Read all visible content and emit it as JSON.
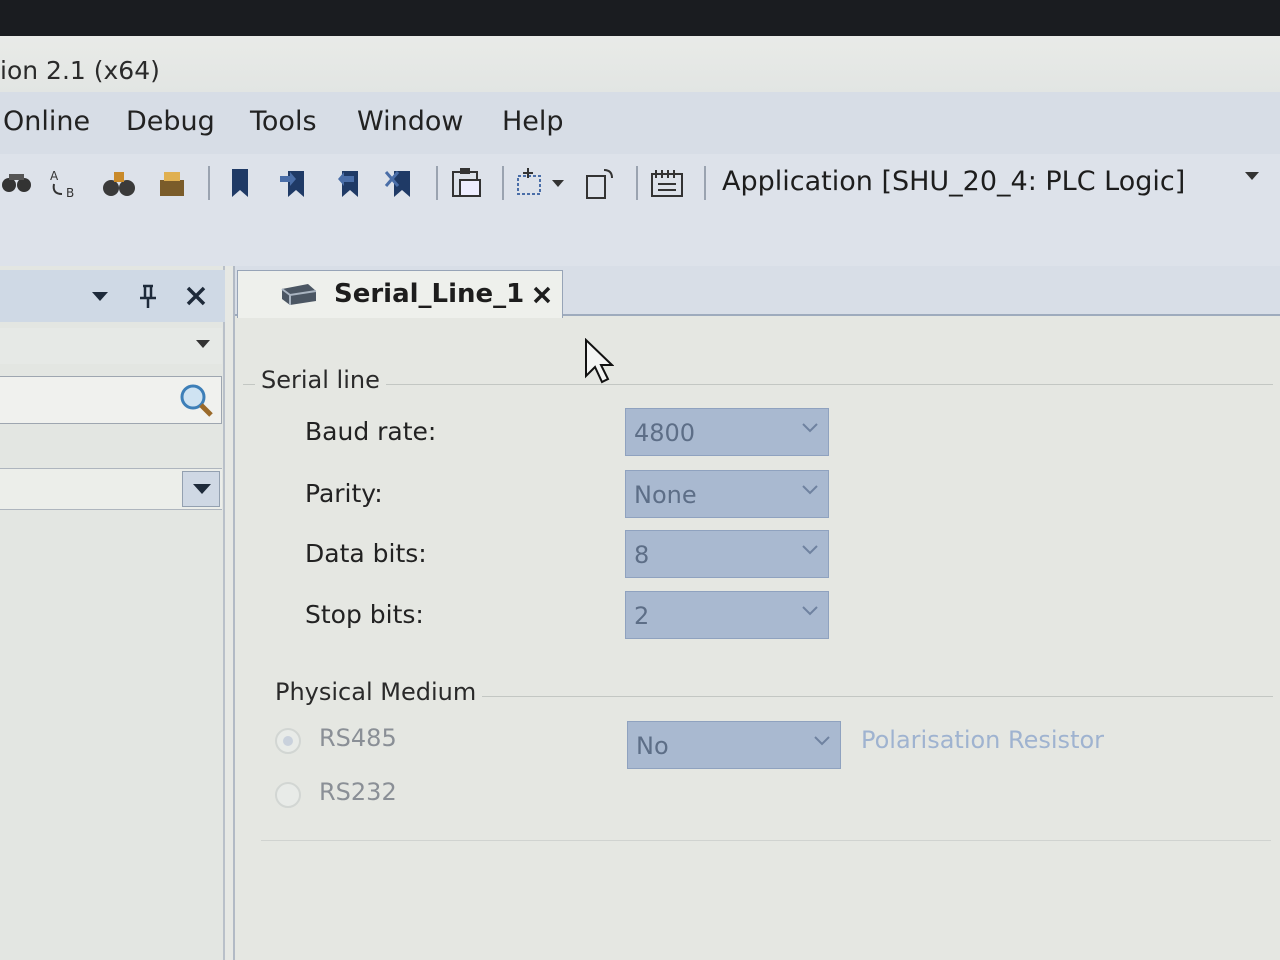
{
  "window": {
    "title": "ion 2.1 (x64)"
  },
  "menu": [
    "Online",
    "Debug",
    "Tools",
    "Window",
    "Help"
  ],
  "toolbar": {
    "icons": [
      "find-icon",
      "find-replace-icon",
      "binoculars-icon",
      "clear-find-icon",
      "bookmark-icon",
      "next-bookmark-icon",
      "prev-bookmark-icon",
      "clear-bookmarks-icon",
      "paste-icon",
      "insert-icon",
      "login-icon",
      "breakpoints-icon"
    ],
    "application": "Application [SHU_20_4: PLC Logic]"
  },
  "editor": {
    "tab_label": "Serial_Line_1",
    "serial_line": {
      "title": "Serial line",
      "fields": [
        {
          "label": "Baud rate:",
          "value": "4800"
        },
        {
          "label": "Parity:",
          "value": "None"
        },
        {
          "label": "Data bits:",
          "value": "8"
        },
        {
          "label": "Stop bits:",
          "value": "2"
        }
      ]
    },
    "physical_medium": {
      "title": "Physical Medium",
      "options": [
        "RS485",
        "RS232"
      ],
      "selected": "RS485",
      "polarisation_value": "No",
      "polarisation_label": "Polarisation Resistor"
    }
  },
  "colors": {
    "combo_bg": "#a9b9d0",
    "tab_strip": "#d8dee7",
    "panel_header": "#cfd9e5"
  }
}
